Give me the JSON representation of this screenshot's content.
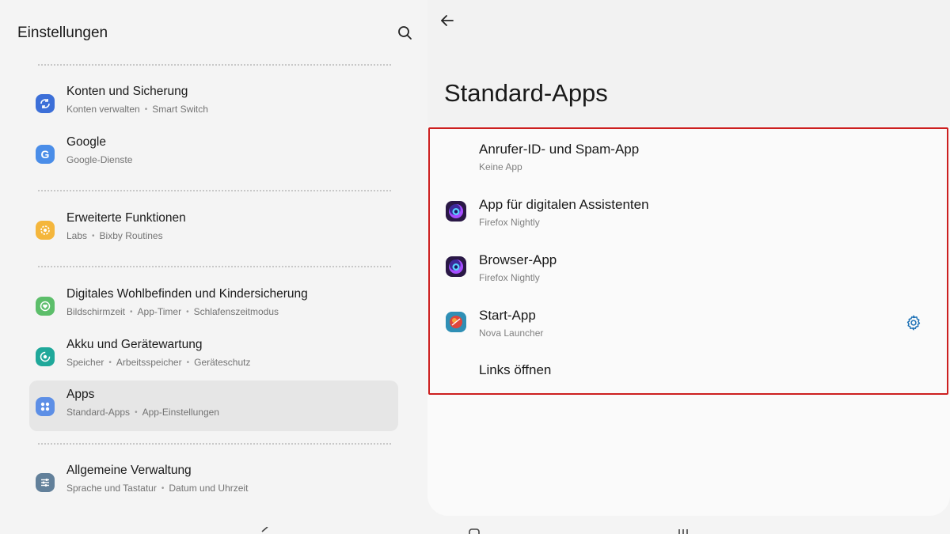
{
  "left": {
    "title": "Einstellungen",
    "items": [
      {
        "title": "Konten und Sicherung",
        "subs": [
          "Konten verwalten",
          "Smart Switch"
        ],
        "icon": "sync-icon",
        "color": "#3c6fd8"
      },
      {
        "title": "Google",
        "subs": [
          "Google-Dienste"
        ],
        "icon": "google-icon",
        "color": "#4a8de8"
      },
      {
        "title": "Erweiterte Funktionen",
        "subs": [
          "Labs",
          "Bixby Routines"
        ],
        "icon": "star-gear-icon",
        "color": "#f4b63c"
      },
      {
        "title": "Digitales Wohlbefinden und Kindersicherung",
        "subs": [
          "Bildschirmzeit",
          "App-Timer",
          "Schlafenszeitmodus"
        ],
        "icon": "wellbeing-icon",
        "color": "#5cbe6a"
      },
      {
        "title": "Akku und Gerätewartung",
        "subs": [
          "Speicher",
          "Arbeitsspeicher",
          "Geräteschutz"
        ],
        "icon": "battery-care-icon",
        "color": "#1fa89a"
      },
      {
        "title": "Apps",
        "subs": [
          "Standard-Apps",
          "App-Einstellungen"
        ],
        "icon": "apps-grid-icon",
        "color": "#5d8fe6",
        "selected": true
      },
      {
        "title": "Allgemeine Verwaltung",
        "subs": [
          "Sprache und Tastatur",
          "Datum und Uhrzeit"
        ],
        "icon": "sliders-icon",
        "color": "#62809a"
      }
    ]
  },
  "right": {
    "title": "Standard-Apps",
    "rows": [
      {
        "title": "Anrufer-ID- und Spam-App",
        "sub": "Keine App",
        "icon": null
      },
      {
        "title": "App für digitalen Assistenten",
        "sub": "Firefox Nightly",
        "icon": "firefox-nightly-icon"
      },
      {
        "title": "Browser-App",
        "sub": "Firefox Nightly",
        "icon": "firefox-nightly-icon"
      },
      {
        "title": "Start-App",
        "sub": "Nova Launcher",
        "icon": "nova-launcher-icon",
        "gear": true
      },
      {
        "title": "Links öffnen",
        "sub": "",
        "icon": null
      }
    ]
  },
  "colors": {
    "highlight": "#cc1f1f",
    "accent": "#1a6fb5"
  }
}
